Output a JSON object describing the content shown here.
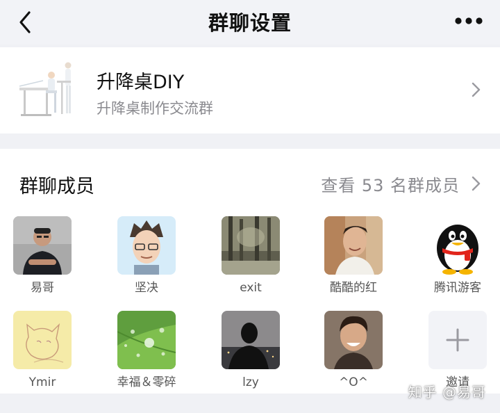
{
  "nav": {
    "title": "群聊设置",
    "back_icon": "chevron-left-icon",
    "more_icon": "more-horizontal-icon"
  },
  "group": {
    "name": "升降桌DIY",
    "description": "升降桌制作交流群"
  },
  "members": {
    "title": "群聊成员",
    "view_all": "查看 53 名群成员",
    "items": [
      {
        "name": "易哥"
      },
      {
        "name": "坚决"
      },
      {
        "name": "exit"
      },
      {
        "name": "酷酷的红"
      },
      {
        "name": "腾讯游客"
      },
      {
        "name": "Ymir"
      },
      {
        "name": "幸福＆零碎"
      },
      {
        "name": "lzy"
      },
      {
        "name": "^O^"
      }
    ],
    "invite_label": "邀请"
  },
  "watermark": "知乎 @易哥",
  "colors": {
    "background": "#f0f1f5",
    "card": "#ffffff",
    "secondary_text": "#8a8a8f",
    "invite_tile": "#f2f3f7"
  }
}
